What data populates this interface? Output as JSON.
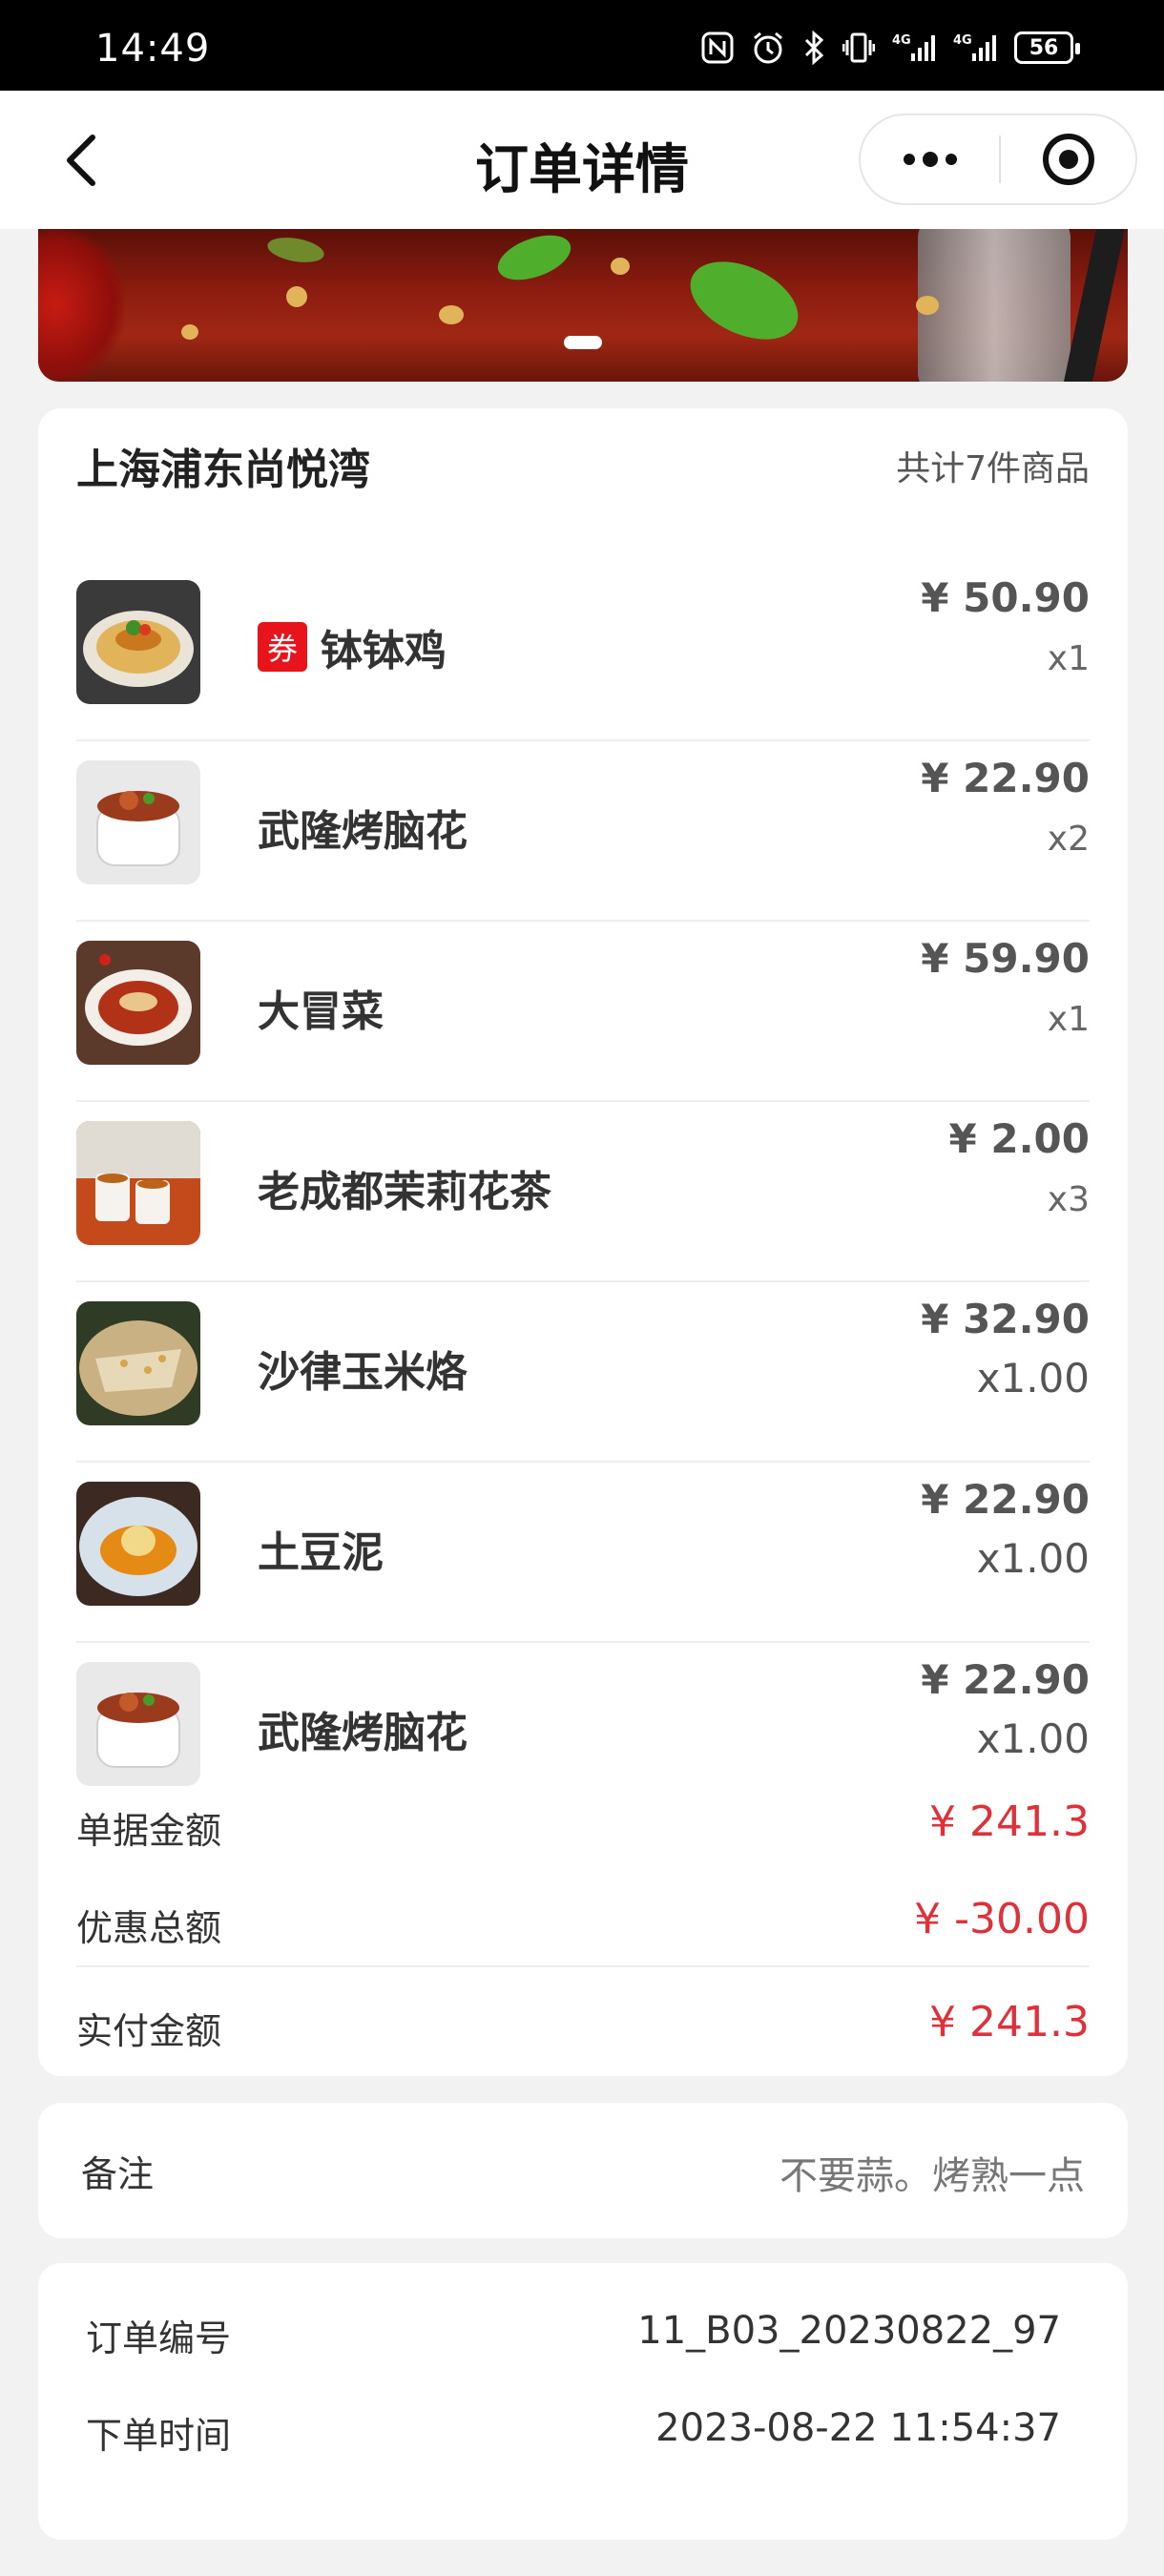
{
  "status_bar": {
    "time": "14:49",
    "battery": "56",
    "icons": [
      "nfc-icon",
      "alarm-icon",
      "bluetooth-icon",
      "vibrate-icon",
      "signal-4g-icon",
      "signal-4g-icon",
      "battery-icon"
    ]
  },
  "header": {
    "title": "订单详情",
    "back_icon": "chevron-left-icon",
    "more_icon": "more-dots-icon",
    "close_icon": "target-circle-icon"
  },
  "order": {
    "store_name": "上海浦东尚悦湾",
    "item_count": "共计7件商品",
    "coupon_label": "券",
    "items": [
      {
        "name": "钵钵鸡",
        "price": "¥ 50.90",
        "qty": "x1",
        "coupon": true
      },
      {
        "name": "武隆烤脑花",
        "price": "¥ 22.90",
        "qty": "x2"
      },
      {
        "name": "大冒菜",
        "price": "¥ 59.90",
        "qty": "x1"
      },
      {
        "name": "老成都茉莉花茶",
        "price": "¥ 2.00",
        "qty": "x3"
      },
      {
        "name": "沙律玉米烙",
        "price": "¥ 32.90",
        "qty": "x1.00"
      },
      {
        "name": "土豆泥",
        "price": "¥ 22.90",
        "qty": "x1.00"
      },
      {
        "name": "武隆烤脑花",
        "price": "¥ 22.90",
        "qty": "x1.00"
      }
    ],
    "summary": [
      {
        "label": "单据金额",
        "value": "¥ 241.3"
      },
      {
        "label": "优惠总额",
        "value": "¥ -30.00"
      },
      {
        "label": "实付金额",
        "value": "¥ 241.3"
      }
    ]
  },
  "remark": {
    "label": "备注",
    "value": "不要蒜。烤熟一点"
  },
  "info": {
    "order_no_label": "订单编号",
    "order_no": "11_B03_20230822_97",
    "time_label": "下单时间",
    "time": "2023-08-22 11:54:37"
  },
  "colors": {
    "accent_red": "#e0303a",
    "coupon_red": "#e8141c",
    "background": "#f2f2f2"
  }
}
